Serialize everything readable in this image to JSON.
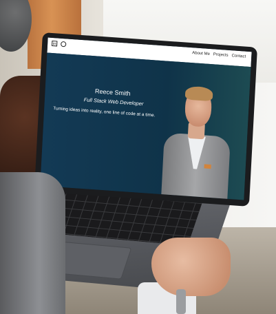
{
  "nav": {
    "icons": [
      "linkedin-icon",
      "github-icon"
    ],
    "links": [
      "About Me",
      "Projects",
      "Contact"
    ]
  },
  "hero": {
    "name": "Reece Smith",
    "role": "Full Stack Web Developer",
    "tagline": "Turning ideas into reality, one line of code at a time."
  },
  "colors": {
    "hero_background": "#0f3349",
    "nav_background": "#ffffff"
  }
}
